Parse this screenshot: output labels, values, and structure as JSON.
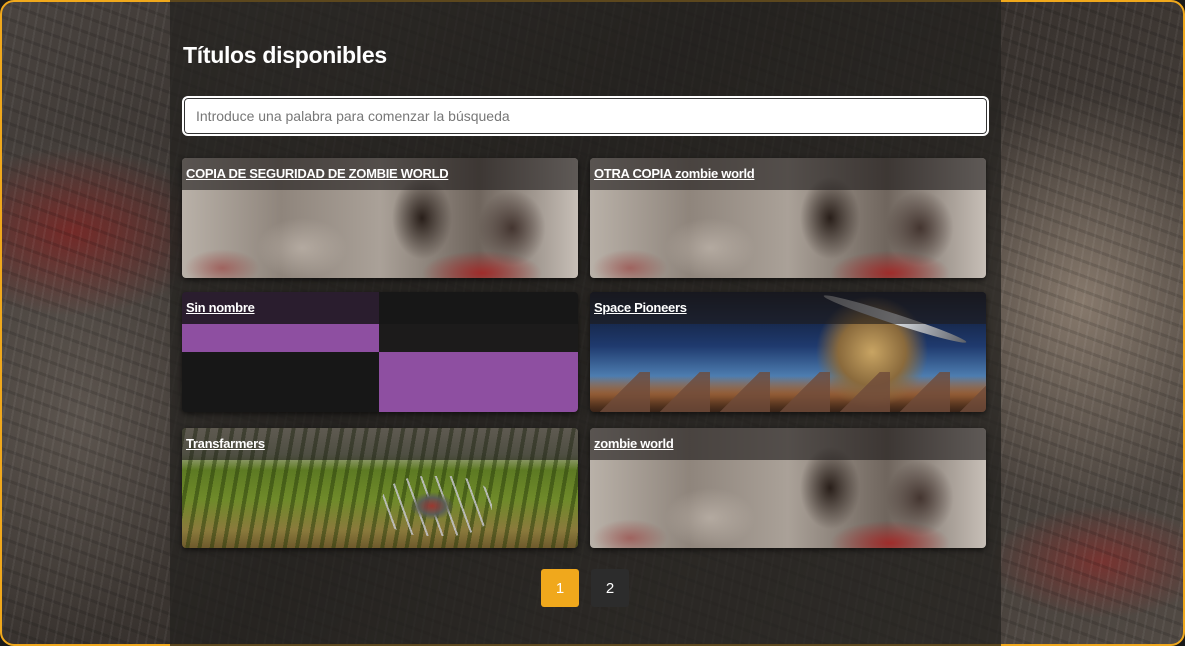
{
  "page": {
    "title": "Títulos disponibles"
  },
  "search": {
    "placeholder": "Introduce una palabra para comenzar la búsqueda",
    "value": ""
  },
  "cards": [
    {
      "label": "COPIA DE SEGURIDAD DE ZOMBIE WORLD",
      "thumbnail": "zombie-image"
    },
    {
      "label": "OTRA COPIA zombie world",
      "thumbnail": "zombie-image"
    },
    {
      "label": "Sin nombre",
      "thumbnail": "purple-blocks-image"
    },
    {
      "label": "Space Pioneers",
      "thumbnail": "space-planet-image"
    },
    {
      "label": "Transfarmers",
      "thumbnail": "field-robot-spider-image"
    },
    {
      "label": "zombie world",
      "thumbnail": "zombie-image"
    }
  ],
  "pagination": {
    "pages": [
      "1",
      "2"
    ],
    "current": "1"
  },
  "colors": {
    "accent": "#f0a81c",
    "frame_border": "#f0a81c",
    "page_inactive": "#2c2c2c"
  }
}
